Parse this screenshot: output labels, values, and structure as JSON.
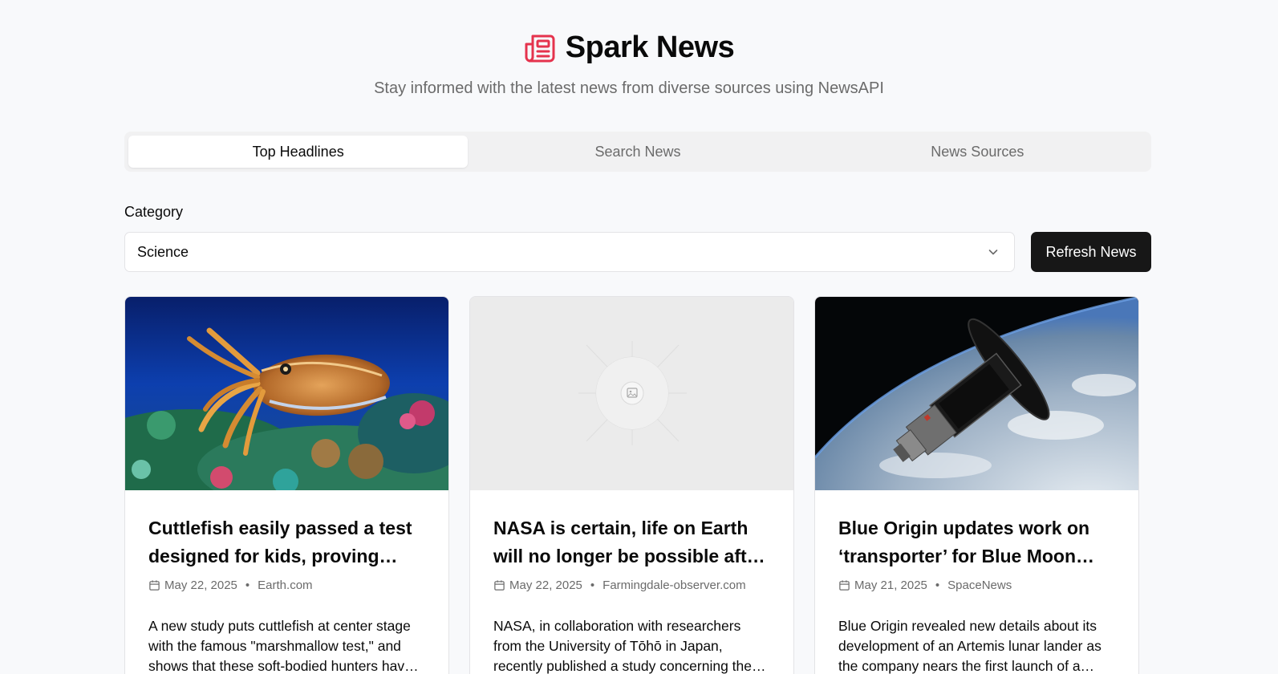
{
  "header": {
    "title": "Spark News",
    "subtitle": "Stay informed with the latest news from diverse sources using NewsAPI",
    "brand_color": "#e5334d"
  },
  "tabs": [
    {
      "label": "Top Headlines",
      "active": true
    },
    {
      "label": "Search News",
      "active": false
    },
    {
      "label": "News Sources",
      "active": false
    }
  ],
  "filter": {
    "category_label": "Category",
    "category_value": "Science",
    "refresh_label": "Refresh News"
  },
  "articles": [
    {
      "title": "Cuttlefish easily passed a test designed for kids, proving…",
      "date": "May 22, 2025",
      "source": "Earth.com",
      "description": "A new study puts cuttlefish at center stage with the famous \"marshmallow test,\" and shows that these soft-bodied hunters hav…",
      "image": "cuttlefish-on-reef"
    },
    {
      "title": "NASA is certain, life on Earth will no longer be possible after this…",
      "date": "May 22, 2025",
      "source": "Farmingdale-observer.com",
      "description": "NASA, in collaboration with researchers from the University of Tōhō in Japan, recently published a study concerning the…",
      "image": "placeholder"
    },
    {
      "title": "Blue Origin updates work on ‘transporter’ for Blue Moon lun…",
      "date": "May 21, 2025",
      "source": "SpaceNews",
      "description": "Blue Origin revealed new details about its development of an Artemis lunar lander as the company nears the first launch of a…",
      "image": "spacecraft-over-earth"
    }
  ]
}
